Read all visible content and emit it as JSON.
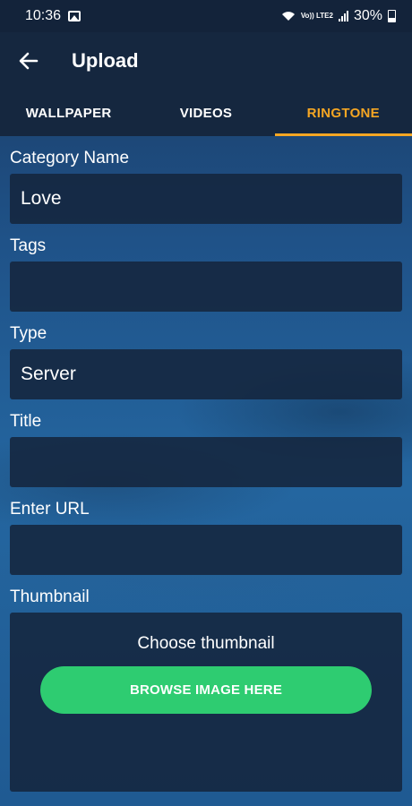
{
  "status_bar": {
    "time": "10:36",
    "network": "Vo)) LTE2",
    "battery": "30%"
  },
  "app_bar": {
    "title": "Upload",
    "back_icon": "arrow-left-icon"
  },
  "tabs": [
    {
      "label": "WALLPAPER",
      "active": false
    },
    {
      "label": "VIDEOS",
      "active": false
    },
    {
      "label": "RINGTONE",
      "active": true
    }
  ],
  "form": {
    "category": {
      "label": "Category Name",
      "value": "Love"
    },
    "tags": {
      "label": "Tags",
      "value": ""
    },
    "type": {
      "label": "Type",
      "value": "Server"
    },
    "title": {
      "label": "Title",
      "value": ""
    },
    "url": {
      "label": "Enter URL",
      "value": ""
    },
    "thumbnail": {
      "label": "Thumbnail",
      "caption": "Choose thumbnail",
      "button": "BROWSE IMAGE HERE"
    }
  },
  "colors": {
    "accent": "#f5a623",
    "button": "#2ecc71",
    "bar": "#15273f"
  }
}
